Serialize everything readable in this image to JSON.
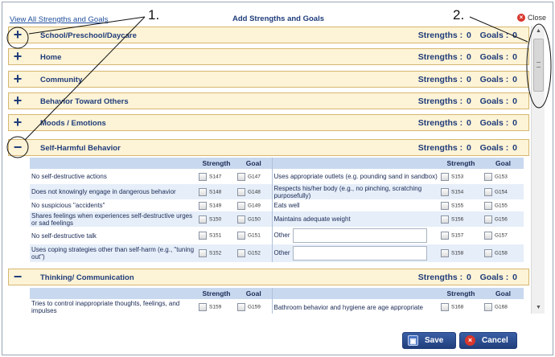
{
  "header": {
    "view_all_link": "View All Strengths and Goals",
    "title": "Add Strengths and Goals",
    "close_label": "Close",
    "close_icon": "close-icon"
  },
  "sections": [
    {
      "toggle": "+",
      "title": "School/Preschool/Daycare",
      "strengths_label": "Strengths :",
      "strengths": "0",
      "goals_label": "Goals :",
      "goals": "0"
    },
    {
      "toggle": "+",
      "title": "Home",
      "strengths_label": "Strengths :",
      "strengths": "0",
      "goals_label": "Goals :",
      "goals": "0"
    },
    {
      "toggle": "+",
      "title": "Community",
      "strengths_label": "Strengths :",
      "strengths": "0",
      "goals_label": "Goals :",
      "goals": "0"
    },
    {
      "toggle": "+",
      "title": "Behavior Toward Others",
      "strengths_label": "Strengths :",
      "strengths": "0",
      "goals_label": "Goals :",
      "goals": "0"
    },
    {
      "toggle": "+",
      "title": "Moods / Emotions",
      "strengths_label": "Strengths :",
      "strengths": "0",
      "goals_label": "Goals :",
      "goals": "0"
    },
    {
      "toggle": "−",
      "title": "Self-Harmful Behavior",
      "strengths_label": "Strengths :",
      "strengths": "0",
      "goals_label": "Goals :",
      "goals": "0"
    },
    {
      "toggle": "−",
      "title": "Thinking/ Communication",
      "strengths_label": "Strengths :",
      "strengths": "0",
      "goals_label": "Goals :",
      "goals": "0"
    }
  ],
  "table_headers": {
    "strength": "Strength",
    "goal": "Goal"
  },
  "other_label": "Other",
  "self_harm_rows": [
    {
      "left": "No self-destructive actions",
      "ls": "S147",
      "lg": "G147",
      "right": "Uses appropriate outlets (e.g. pounding sand in sandbox)",
      "rs": "S153",
      "rg": "G153"
    },
    {
      "left": "Does not knowingly engage in dangerous behavior",
      "ls": "S148",
      "lg": "G148",
      "right": "Respects his/her body (e.g., no pinching, scratching purposefully)",
      "rs": "S154",
      "rg": "G154"
    },
    {
      "left": "No suspicious \"accidents\"",
      "ls": "S149",
      "lg": "G149",
      "right": "Eats well",
      "rs": "S155",
      "rg": "G155"
    },
    {
      "left": "Shares feelings when experiences self-destructive urges or sad feelings",
      "ls": "S150",
      "lg": "G150",
      "right": "Maintains adequate weight",
      "rs": "S156",
      "rg": "G156"
    },
    {
      "left": "No self-destructive talk",
      "ls": "S151",
      "lg": "G151",
      "right": "",
      "rs": "S157",
      "rg": "G157"
    },
    {
      "left": "Uses coping strategies other than self-harm (e.g., \"tuning out\")",
      "ls": "S152",
      "lg": "G152",
      "right": "",
      "rs": "S158",
      "rg": "G158"
    }
  ],
  "thinking_rows": [
    {
      "left": "Tries to control inappropriate thoughts, feelings, and impulses",
      "ls": "S159",
      "lg": "G159",
      "right": "Bathroom behavior and hygiene are age appropriate",
      "rs": "S168",
      "rg": "G168"
    }
  ],
  "buttons": {
    "save": "Save",
    "cancel": "Cancel"
  },
  "annotations": {
    "one": "1.",
    "two": "2."
  },
  "colors": {
    "section_bg": "#fdf3d6",
    "section_border": "#d5b770",
    "header_blue": "#c8d9ef",
    "button_blue": "#213f7c",
    "close_red": "#d9362b"
  }
}
